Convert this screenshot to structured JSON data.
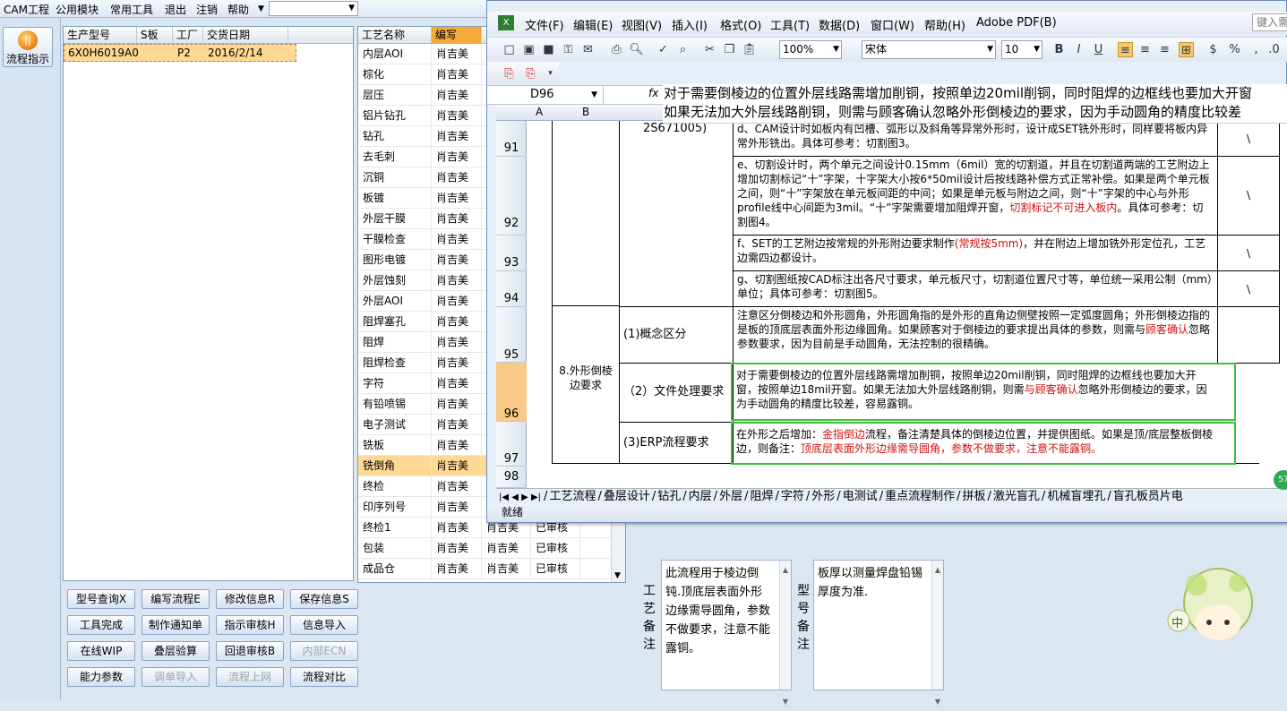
{
  "menubar": {
    "items": [
      "CAM工程",
      "公用模块",
      "常用工具",
      "退出",
      "注销",
      "帮助"
    ]
  },
  "left": {
    "flow_button_label": "流程指示"
  },
  "order_table": {
    "headers": [
      "生产型号",
      "S板",
      "工厂",
      "交货日期"
    ],
    "rows": [
      [
        "6X0H6019A0",
        "",
        "P2",
        "2016/2/14"
      ]
    ]
  },
  "process_table": {
    "headers": [
      "工艺名称",
      "编写"
    ],
    "rows": [
      [
        "内层AOI",
        "肖吉美",
        "",
        ""
      ],
      [
        "棕化",
        "肖吉美",
        "",
        ""
      ],
      [
        "层压",
        "肖吉美",
        "",
        ""
      ],
      [
        "铝片钻孔",
        "肖吉美",
        "",
        ""
      ],
      [
        "钻孔",
        "肖吉美",
        "",
        ""
      ],
      [
        "去毛刺",
        "肖吉美",
        "",
        ""
      ],
      [
        "沉铜",
        "肖吉美",
        "",
        ""
      ],
      [
        "板镀",
        "肖吉美",
        "",
        ""
      ],
      [
        "外层干膜",
        "肖吉美",
        "",
        ""
      ],
      [
        "干膜检查",
        "肖吉美",
        "",
        ""
      ],
      [
        "图形电镀",
        "肖吉美",
        "",
        ""
      ],
      [
        "外层蚀刻",
        "肖吉美",
        "",
        ""
      ],
      [
        "外层AOI",
        "肖吉美",
        "",
        ""
      ],
      [
        "阻焊塞孔",
        "肖吉美",
        "",
        ""
      ],
      [
        "阻焊",
        "肖吉美",
        "",
        ""
      ],
      [
        "阻焊检查",
        "肖吉美",
        "",
        ""
      ],
      [
        "字符",
        "肖吉美",
        "",
        ""
      ],
      [
        "有铅喷锡",
        "肖吉美",
        "",
        ""
      ],
      [
        "电子测试",
        "肖吉美",
        "",
        ""
      ],
      [
        "铣板",
        "肖吉美",
        "",
        ""
      ],
      [
        "铣倒角",
        "肖吉美",
        "",
        ""
      ],
      [
        "终检",
        "肖吉美",
        "",
        ""
      ],
      [
        "印序列号",
        "肖吉美",
        "",
        ""
      ],
      [
        "终检1",
        "肖吉美",
        "肖吉美",
        "已审核"
      ],
      [
        "包装",
        "肖吉美",
        "肖吉美",
        "已审核"
      ],
      [
        "成品仓",
        "肖吉美",
        "肖吉美",
        "已审核"
      ]
    ]
  },
  "buttons": [
    {
      "label": "型号查询X",
      "enabled": true
    },
    {
      "label": "编写流程E",
      "enabled": true
    },
    {
      "label": "修改信息R",
      "enabled": true
    },
    {
      "label": "保存信息S",
      "enabled": true
    },
    {
      "label": "工具完成",
      "enabled": true
    },
    {
      "label": "制作通知单",
      "enabled": true
    },
    {
      "label": "指示审核H",
      "enabled": true
    },
    {
      "label": "信息导入",
      "enabled": true
    },
    {
      "label": "在线WIP",
      "enabled": true
    },
    {
      "label": "叠层验算",
      "enabled": true
    },
    {
      "label": "回退审核B",
      "enabled": true
    },
    {
      "label": "内部ECN",
      "enabled": false
    },
    {
      "label": "能力参数",
      "enabled": true
    },
    {
      "label": "调单导入",
      "enabled": false
    },
    {
      "label": "流程上网",
      "enabled": false
    },
    {
      "label": "流程对比",
      "enabled": true
    }
  ],
  "remarks": {
    "process_label": "工艺备注",
    "process_text": "此流程用于棱边倒钝.顶底层表面外形边缘需导圆角，参数不做要求，注意不能露铜。",
    "model_label": "型号备注",
    "model_text": "板厚以测量焊盘铅锡厚度为准."
  },
  "excel": {
    "menu": [
      "文件(F)",
      "编辑(E)",
      "视图(V)",
      "插入(I)",
      "格式(O)",
      "工具(T)",
      "数据(D)",
      "窗口(W)",
      "帮助(H)",
      "Adobe PDF(B)"
    ],
    "help_box": "键入需",
    "zoom": "100%",
    "font": "宋体",
    "font_size": "10",
    "name_box": "D96",
    "formula_line1": "对于需要倒棱边的位置外层线路需增加削铜，按照单边20mil削铜，同时阻焊的边框线也要加大开窗",
    "formula_line2": "如果无法加大外层线路削铜，则需与顾客确认忽略外形倒棱边的要求，因为手动圆角的精度比较差",
    "col_headers": [
      "A",
      "B"
    ],
    "row_numbers": [
      "91",
      "92",
      "93",
      "94",
      "95",
      "96",
      "97",
      "98"
    ],
    "cells": {
      "c91_left": "2S671005)",
      "c91": "d、CAM设计时如板内有凹槽、弧形以及斜角等异常外形时，设计成SET铣外形时，同样要将板内异常外形铣出。具体可参考：切割图3。",
      "c92_a": "e、切割设计时，两个单元之间设计0.15mm（6mil）宽的切割道，并且在切割道两端的工艺附边上增加切割标记“十”字架，十字架大小按6*50mil设计后按线路补偿方式正常补偿。如果是两个单元板之间，则“十”字架放在单元板间距的中间；如果是单元板与附边之间，则“十”字架的中心与外形profile线中心间距为3mil。“十”字架需要增加阻焊开窗，",
      "c92_red": "切割标记不可进入板内",
      "c92_b": "。具体可参考：切割图4。",
      "c93_a": "f、SET的工艺附边按常规的外形附边要求制作",
      "c93_red": "(常规按5mm)",
      "c93_b": "，并在附边上增加铣外形定位孔，工艺边需四边都设计。",
      "c94": "g、切割图纸按CAD标注出各尺寸要求，单元板尺寸，切割道位置尺寸等，单位统一采用公制（mm）单位；具体可参考：切割图5。",
      "section": "8.外形倒棱边要求",
      "c95_label": "(1)概念区分",
      "c95_a": "注意区分倒棱边和外形圆角，外形圆角指的是外形的直角边侧壁按照一定弧度圆角；外形倒棱边指的是板的顶底层表面外形边缘圆角。如果顾客对于倒棱边的要求提出具体的参数，则需与",
      "c95_red": "顾客确认",
      "c95_b": "忽略参数要求，因为目前是手动圆角，无法控制的很精确。",
      "c96_label": "（2）文件处理要求",
      "c96_a": "对于需要倒棱边的位置外层线路需增加削铜，按照单边20mil削铜，同时阻焊的边框线也要加大开窗，按照单边18mil开窗。如果无法加大外层线路削铜，则需",
      "c96_red": "与顾客确认",
      "c96_b": "忽略外形倒棱边的要求，因为手动圆角的精度比较差，容易露铜。",
      "c97_label": "(3)ERP流程要求",
      "c97_a": "在外形之后增加：",
      "c97_red1": "金指倒边",
      "c97_b": "流程，备注清楚具体的倒棱边位置，并提供图纸。如果是顶/底层整板倒棱边，则备注：",
      "c97_red2": "顶底层表面外形边缘需导圆角，参数不做要求，注意不能露铜。",
      "slash": "\\"
    },
    "sheet_tabs": [
      "工艺流程",
      "叠层设计",
      "钻孔",
      "内层",
      "外层",
      "阻焊",
      "字符",
      "外形",
      "电测试",
      "重点流程制作",
      "拼板",
      "激光盲孔",
      "机械盲埋孔",
      "盲孔板员片电"
    ],
    "status": "就绪"
  },
  "mascot": {
    "label": "中",
    "badge": "57"
  },
  "colors": {
    "selection": "#ffd993",
    "highlight_box": "#3fbf3f",
    "red_text": "#d01010"
  }
}
